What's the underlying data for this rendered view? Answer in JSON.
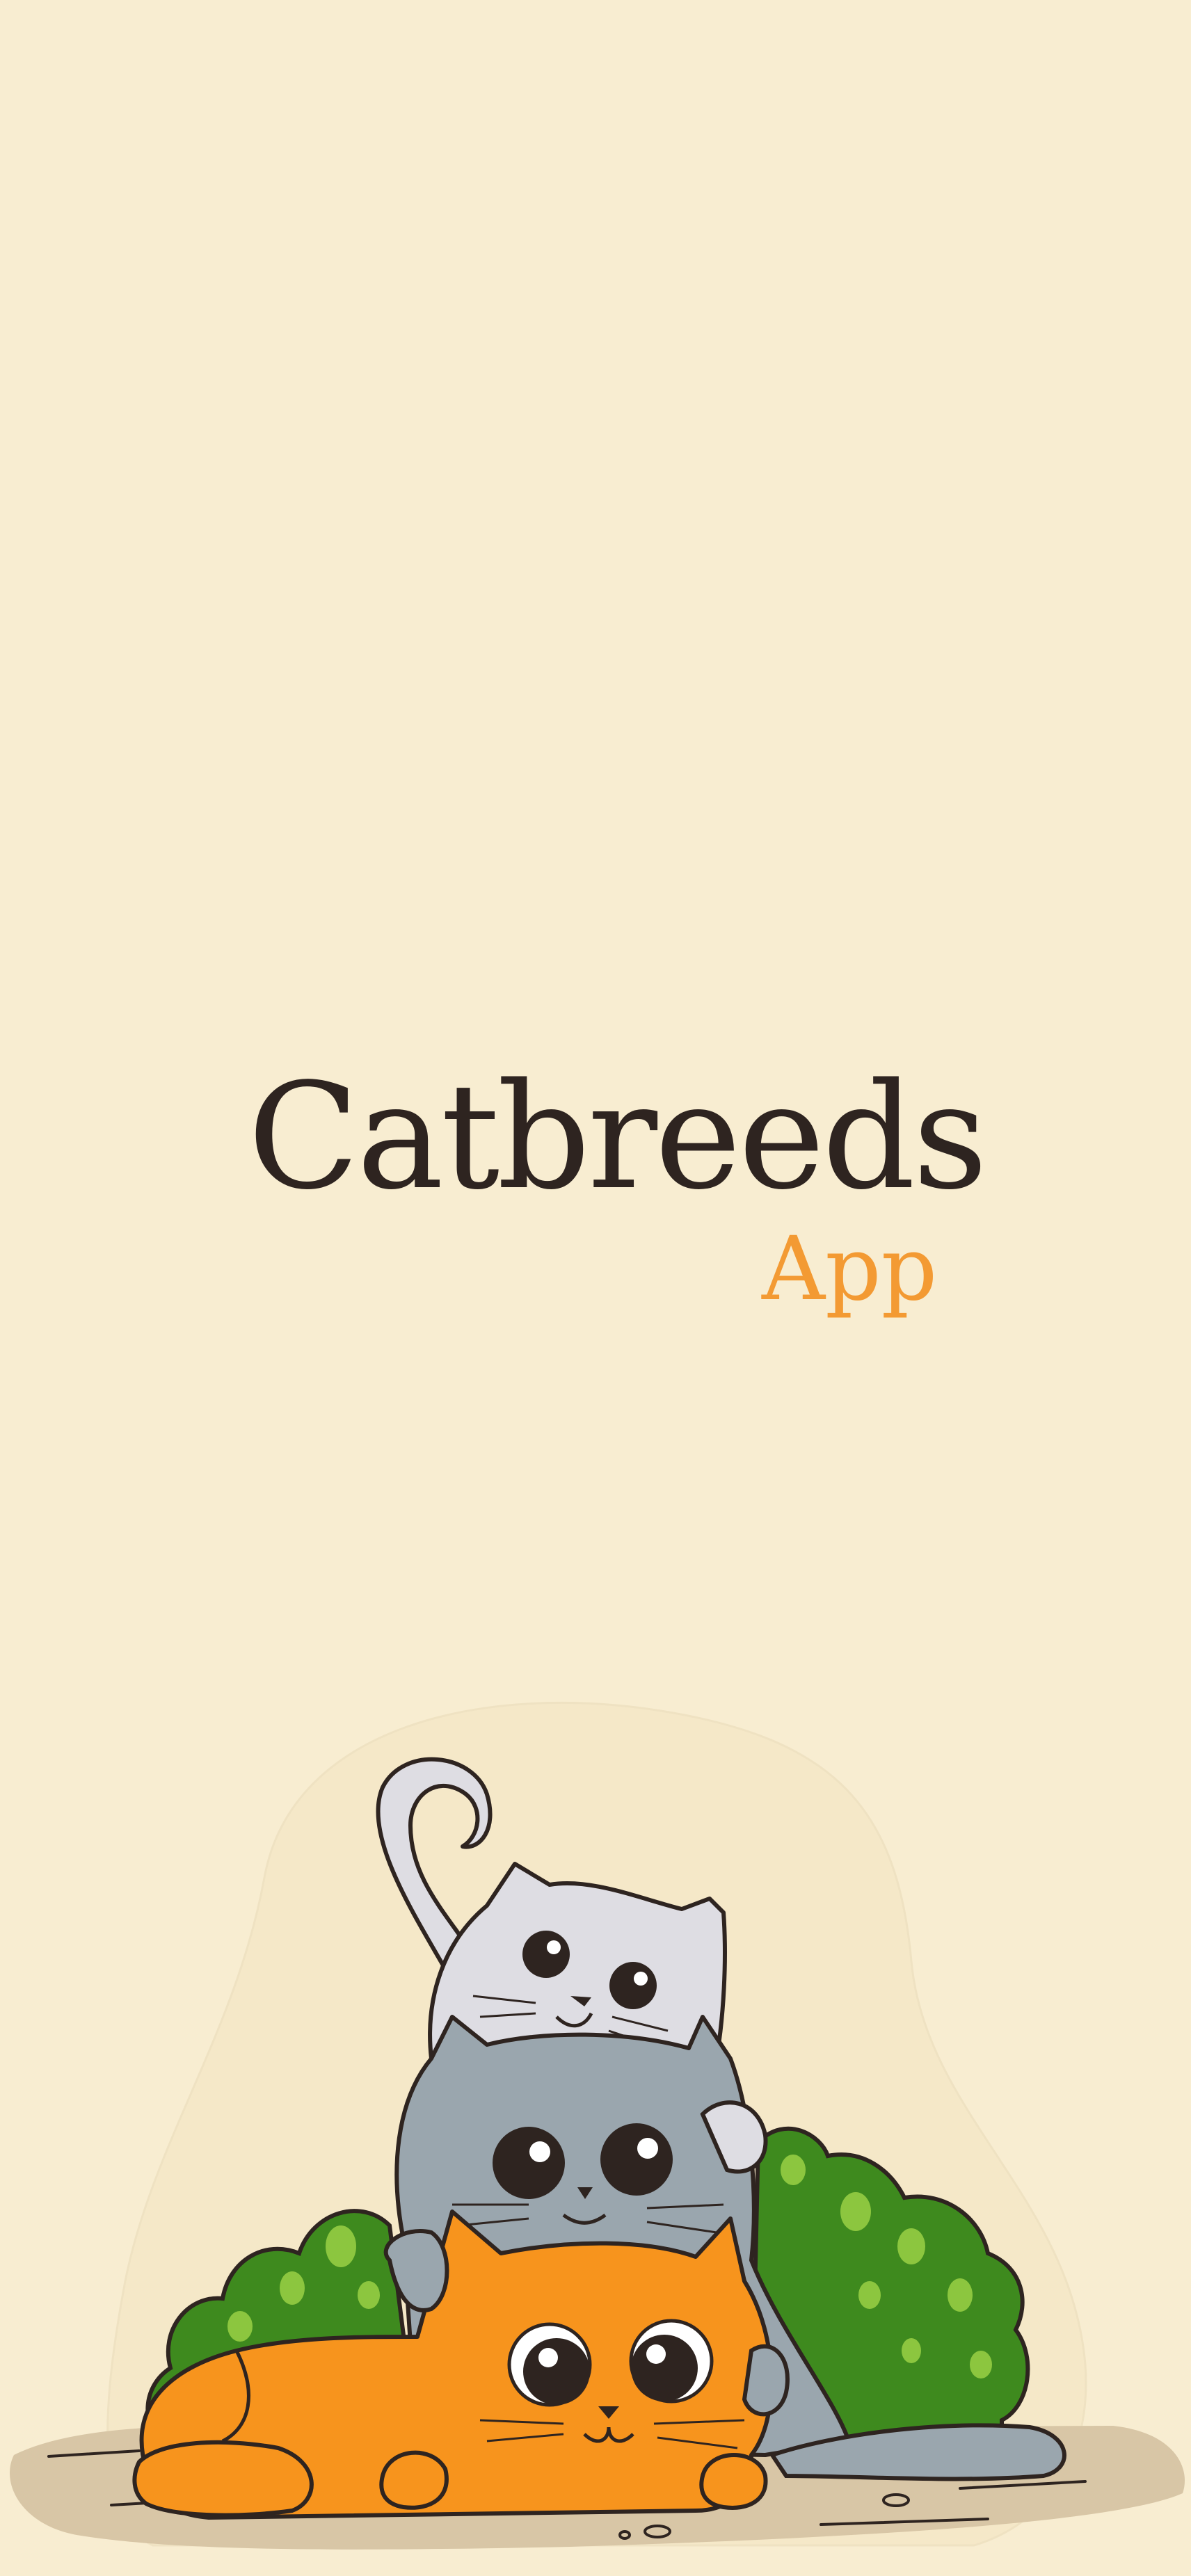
{
  "splash": {
    "title": "Catbreeds",
    "subtitle": "App"
  },
  "colors": {
    "background": "#F8EDD1",
    "title": "#2E2420",
    "accent": "#F39A33",
    "bush": "#3E8A1E",
    "bush_light": "#8CC63F",
    "cat_orange": "#F7941D",
    "cat_grey": "#9AA6AE",
    "cat_white": "#DEDDE3",
    "ground": "#D8C6A6"
  },
  "illustration": {
    "icon": "three-stacked-cats-icon"
  }
}
